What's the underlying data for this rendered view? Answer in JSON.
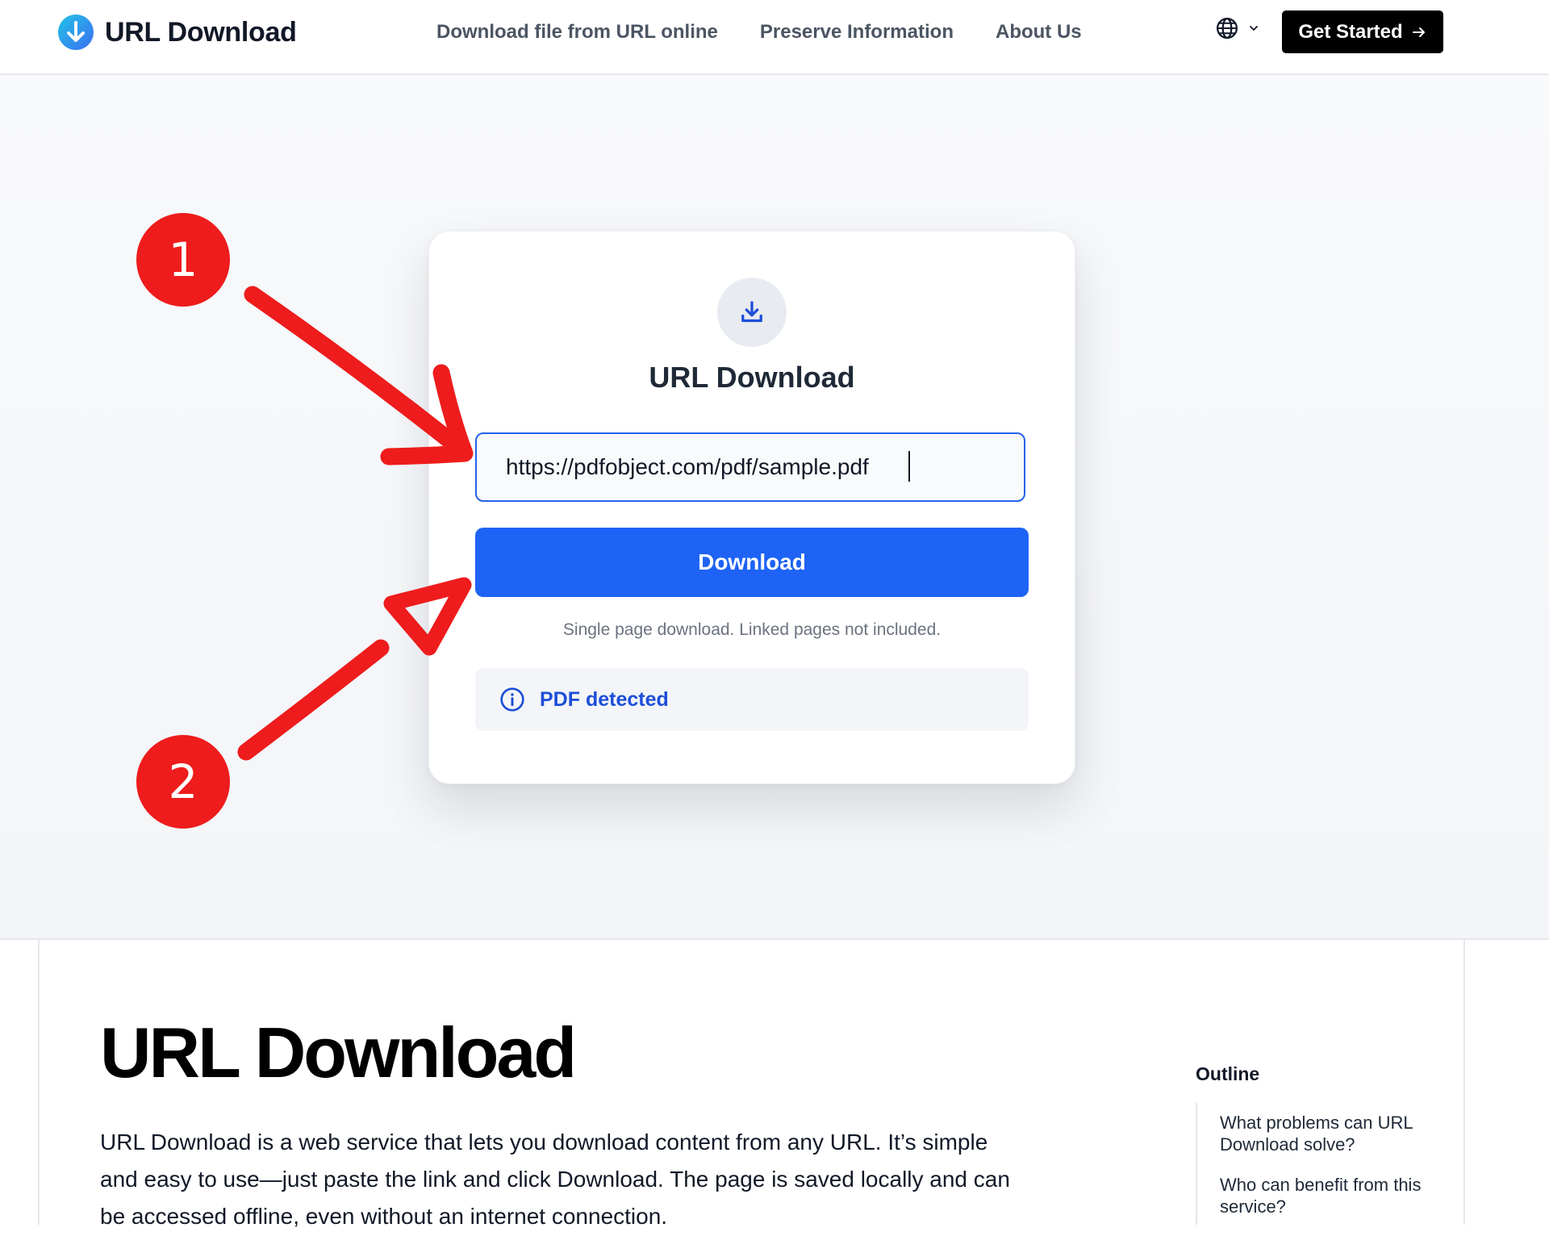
{
  "header": {
    "brand": "URL Download",
    "nav": [
      {
        "label": "Download file from URL online"
      },
      {
        "label": "Preserve Information"
      },
      {
        "label": "About Us"
      }
    ],
    "cta_label": "Get Started"
  },
  "card": {
    "title": "URL Download",
    "url_value": "https://pdfobject.com/pdf/sample.pdf",
    "download_label": "Download",
    "hint": "Single page download. Linked pages not included.",
    "notice": "PDF detected"
  },
  "annotations": {
    "badge1": "1",
    "badge2": "2"
  },
  "article": {
    "title": "URL Download",
    "body": "URL Download is a web service that lets you download content from any URL. It’s simple and easy to use—just paste the link and click Download. The page is saved locally and can be accessed offline, even without an internet connection."
  },
  "outline": {
    "title": "Outline",
    "items": [
      {
        "label": "What problems can URL Download solve?"
      },
      {
        "label": "Who can benefit from this service?"
      }
    ]
  },
  "colors": {
    "accent": "#1e63f5",
    "annotation_red": "#ee1c1c",
    "cta_bg": "#000000",
    "notice_text": "#1d4ed8"
  },
  "icons": [
    "download-circle-logo-icon",
    "globe-icon",
    "chevron-down-icon",
    "arrow-right-icon",
    "download-tray-icon",
    "info-circle-icon"
  ]
}
